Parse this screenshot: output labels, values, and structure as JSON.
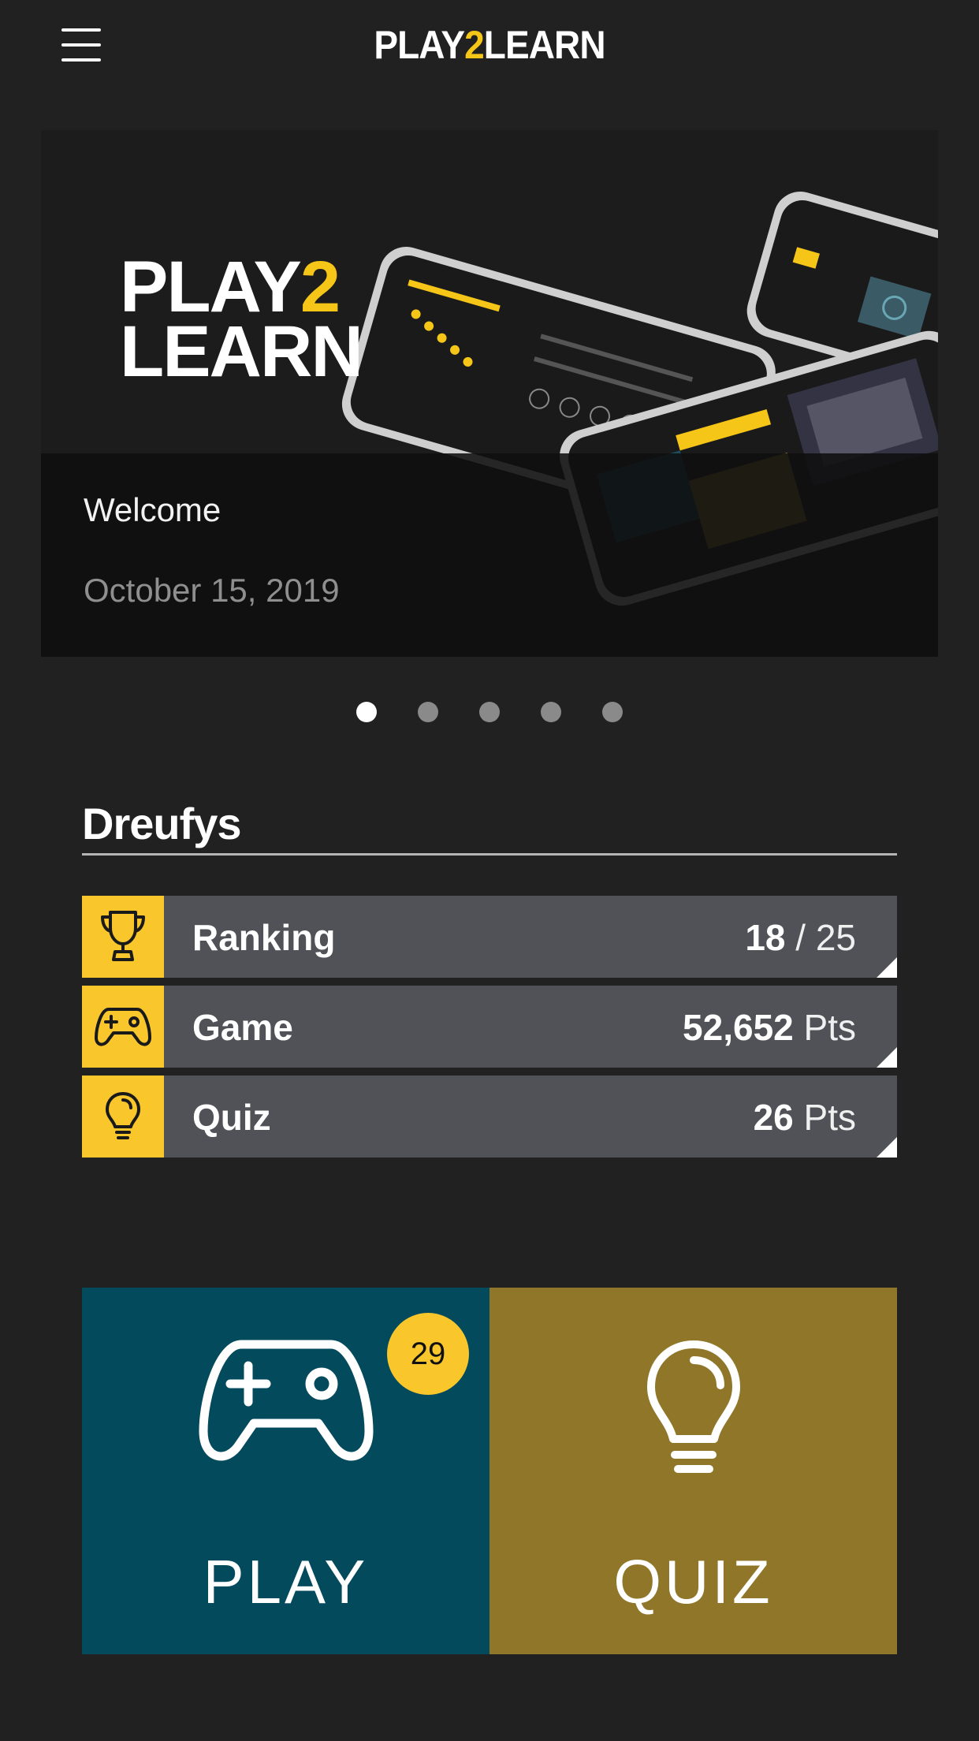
{
  "header": {
    "logo_prefix": "PLAY",
    "logo_number": "2",
    "logo_suffix": "LEARN",
    "menu_icon": "hamburger-menu-icon"
  },
  "carousel": {
    "banner_logo_line1": "PLAY",
    "banner_logo_number": "2",
    "banner_logo_line2": "LEARN",
    "title": "Welcome",
    "date": "October 15, 2019",
    "slide_count": 5,
    "active_slide": 1
  },
  "profile": {
    "username": "Dreufys",
    "stats": [
      {
        "label": "Ranking",
        "value": "18",
        "unit": "/ 25",
        "icon": "trophy-icon"
      },
      {
        "label": "Game",
        "value": "52,652",
        "unit": "Pts",
        "icon": "gamepad-icon"
      },
      {
        "label": "Quiz",
        "value": "26",
        "unit": "Pts",
        "icon": "lightbulb-icon"
      }
    ]
  },
  "tiles": {
    "play": {
      "label": "PLAY",
      "badge": "29",
      "icon": "gamepad-icon"
    },
    "quiz": {
      "label": "QUIZ",
      "icon": "lightbulb-icon"
    }
  },
  "colors": {
    "background": "#212121",
    "accent_yellow": "#f9c72b",
    "stat_row": "#505257",
    "play_tile": "#024a5c",
    "quiz_tile": "#8f7629"
  }
}
